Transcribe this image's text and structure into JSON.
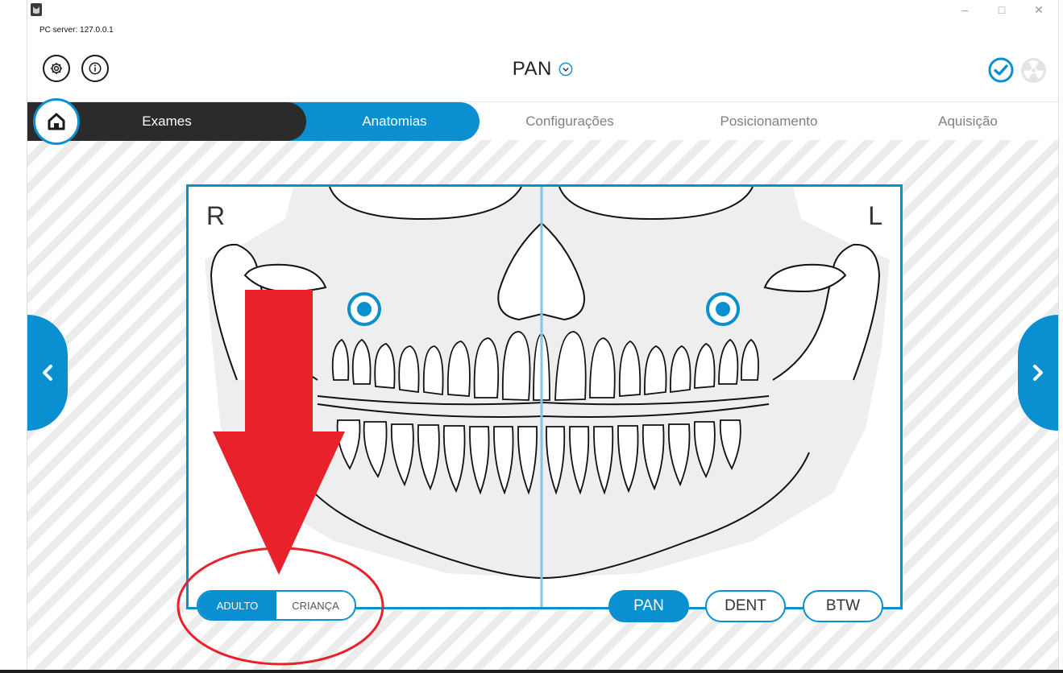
{
  "window": {
    "server_label": "PC server: 127.0.0.1",
    "controls": [
      "–",
      "□",
      "✕"
    ]
  },
  "header": {
    "title": "PAN",
    "settings_icon": "gear-icon",
    "info_icon": "info-icon",
    "status_icons": [
      "check-circle-icon",
      "radiation-icon"
    ]
  },
  "tabs": [
    {
      "label": "Exames",
      "state": "completed"
    },
    {
      "label": "Anatomias",
      "state": "active"
    },
    {
      "label": "Configurações",
      "state": "inactive"
    },
    {
      "label": "Posicionamento",
      "state": "inactive"
    },
    {
      "label": "Aquisição",
      "state": "inactive"
    }
  ],
  "anatomy": {
    "right_label": "R",
    "left_label": "L"
  },
  "patient_type": {
    "options": [
      "ADULTO",
      "CRIANÇA"
    ],
    "selected": "ADULTO"
  },
  "exam_modes": {
    "options": [
      "PAN",
      "DENT",
      "BTW"
    ],
    "selected": "PAN"
  },
  "colors": {
    "accent": "#0a90d0",
    "dark": "#2b2b2b",
    "annotation": "#e8212b"
  }
}
